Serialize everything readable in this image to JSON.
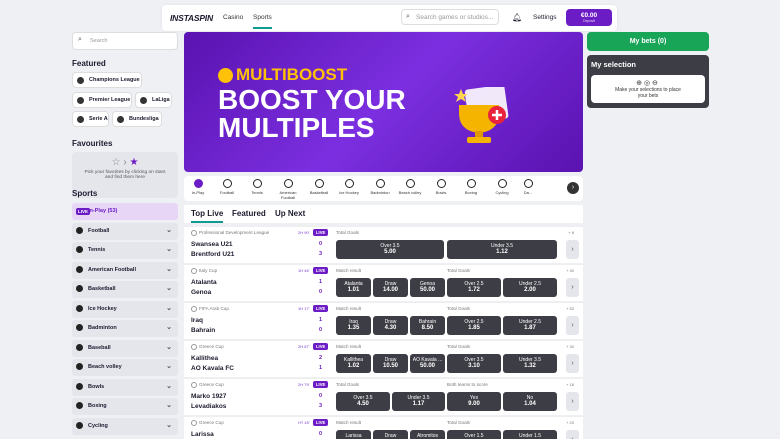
{
  "header": {
    "logo": "INSTASPIN",
    "nav": [
      "Casino",
      "Sports"
    ],
    "search_placeholder": "Search games or studios...",
    "settings": "Settings",
    "balance": "€0.00",
    "balance_sub": "Deposit"
  },
  "left": {
    "search_placeholder": "Search",
    "featured_title": "Featured",
    "featured": [
      "Champions League",
      "Premier League",
      "LaLiga",
      "Serie A",
      "Bundesliga"
    ],
    "favourites_title": "Favourites",
    "favourites_text": "Pick your favorites by clicking on stars and find them here",
    "sports_title": "Sports",
    "inplay": {
      "label": "In-Play",
      "count": "(53)"
    },
    "sports": [
      "Football",
      "Tennis",
      "American Football",
      "Basketball",
      "Ice Hockey",
      "Badminton",
      "Baseball",
      "Beach volley",
      "Bowls",
      "Boxing",
      "Cycling"
    ]
  },
  "banner": {
    "line1": "MULTIBOOST",
    "line2": "BOOST YOUR",
    "line3": "MULTIPLES"
  },
  "categories": [
    "In-Play",
    "Football",
    "Tennis",
    "American Football",
    "Basketball",
    "Ice Hockey",
    "Badminton",
    "Beach volley",
    "Bowls",
    "Boxing",
    "Cycling",
    "Da..."
  ],
  "tabs": [
    "Top Live",
    "Featured",
    "Up Next"
  ],
  "matches": [
    {
      "league": "Professional Development League",
      "time": "2H 90'",
      "live": "LIVE",
      "home": "Swansea U21",
      "away": "Brentford U21",
      "s1": "0",
      "s2": "3",
      "label1": "Total Goals",
      "label2": "",
      "count": "+ 8",
      "odds": [
        {
          "l": "Over 3.5",
          "v": "5.00"
        },
        {
          "l": "Under 3.5",
          "v": "1.12"
        }
      ]
    },
    {
      "league": "Italy Cup",
      "time": "1H 46'",
      "live": "LIVE",
      "home": "Atalanta",
      "away": "Genoa",
      "s1": "1",
      "s2": "0",
      "label1": "Match result",
      "label2": "Total Goals",
      "count": "+ 40",
      "odds": [
        {
          "l": "Atalanta",
          "v": "1.01"
        },
        {
          "l": "Draw",
          "v": "14.00"
        },
        {
          "l": "Genoa",
          "v": "50.00"
        },
        {
          "l": "Over 2.5",
          "v": "1.72"
        },
        {
          "l": "Under 2.5",
          "v": "2.00"
        }
      ]
    },
    {
      "league": "FIFA Arab Cup",
      "time": "1H 17'",
      "live": "LIVE",
      "home": "Iraq",
      "away": "Bahrain",
      "s1": "1",
      "s2": "0",
      "label1": "Match result",
      "label2": "Total Goals",
      "count": "+ 53",
      "odds": [
        {
          "l": "Iraq",
          "v": "1.35"
        },
        {
          "l": "Draw",
          "v": "4.30"
        },
        {
          "l": "Bahrain",
          "v": "8.50"
        },
        {
          "l": "Over 2.5",
          "v": "1.85"
        },
        {
          "l": "Under 2.5",
          "v": "1.87"
        }
      ]
    },
    {
      "league": "Greece Cup",
      "time": "2H 87'",
      "live": "LIVE",
      "home": "Kallithea",
      "away": "AO Kavala FC",
      "s1": "2",
      "s2": "1",
      "label1": "Match result",
      "label2": "Total Goals",
      "count": "+ 30",
      "odds": [
        {
          "l": "Kallithea",
          "v": "1.02"
        },
        {
          "l": "Draw",
          "v": "10.50"
        },
        {
          "l": "AO Kavala ...",
          "v": "50.00"
        },
        {
          "l": "Over 3.5",
          "v": "3.10"
        },
        {
          "l": "Under 3.5",
          "v": "1.32"
        }
      ]
    },
    {
      "league": "Greece Cup",
      "time": "2H 79'",
      "live": "LIVE",
      "home": "Marko 1927",
      "away": "Levadiakos",
      "s1": "0",
      "s2": "3",
      "label1": "Total Goals",
      "label2": "Both teams to score",
      "count": "+ 16",
      "odds": [
        {
          "l": "Over 3.5",
          "v": "4.50"
        },
        {
          "l": "Under 3.5",
          "v": "1.17"
        },
        {
          "l": "Yes",
          "v": "9.00"
        },
        {
          "l": "No",
          "v": "1.04"
        }
      ]
    },
    {
      "league": "Greece Cup",
      "time": "HT 45'",
      "live": "LIVE",
      "home": "Larissa",
      "away": "",
      "s1": "0",
      "s2": "",
      "label1": "Match result",
      "label2": "Total Goals",
      "count": "+ 20",
      "odds": [
        {
          "l": "Larissa",
          "v": ""
        },
        {
          "l": "Draw",
          "v": ""
        },
        {
          "l": "Atromitos",
          "v": ""
        },
        {
          "l": "Over 1.5",
          "v": ""
        },
        {
          "l": "Under 1.5",
          "v": ""
        }
      ]
    }
  ],
  "right": {
    "mybets": "My bets (0)",
    "selection_title": "My selection",
    "selection_text": "Make your selections to place your bets"
  }
}
